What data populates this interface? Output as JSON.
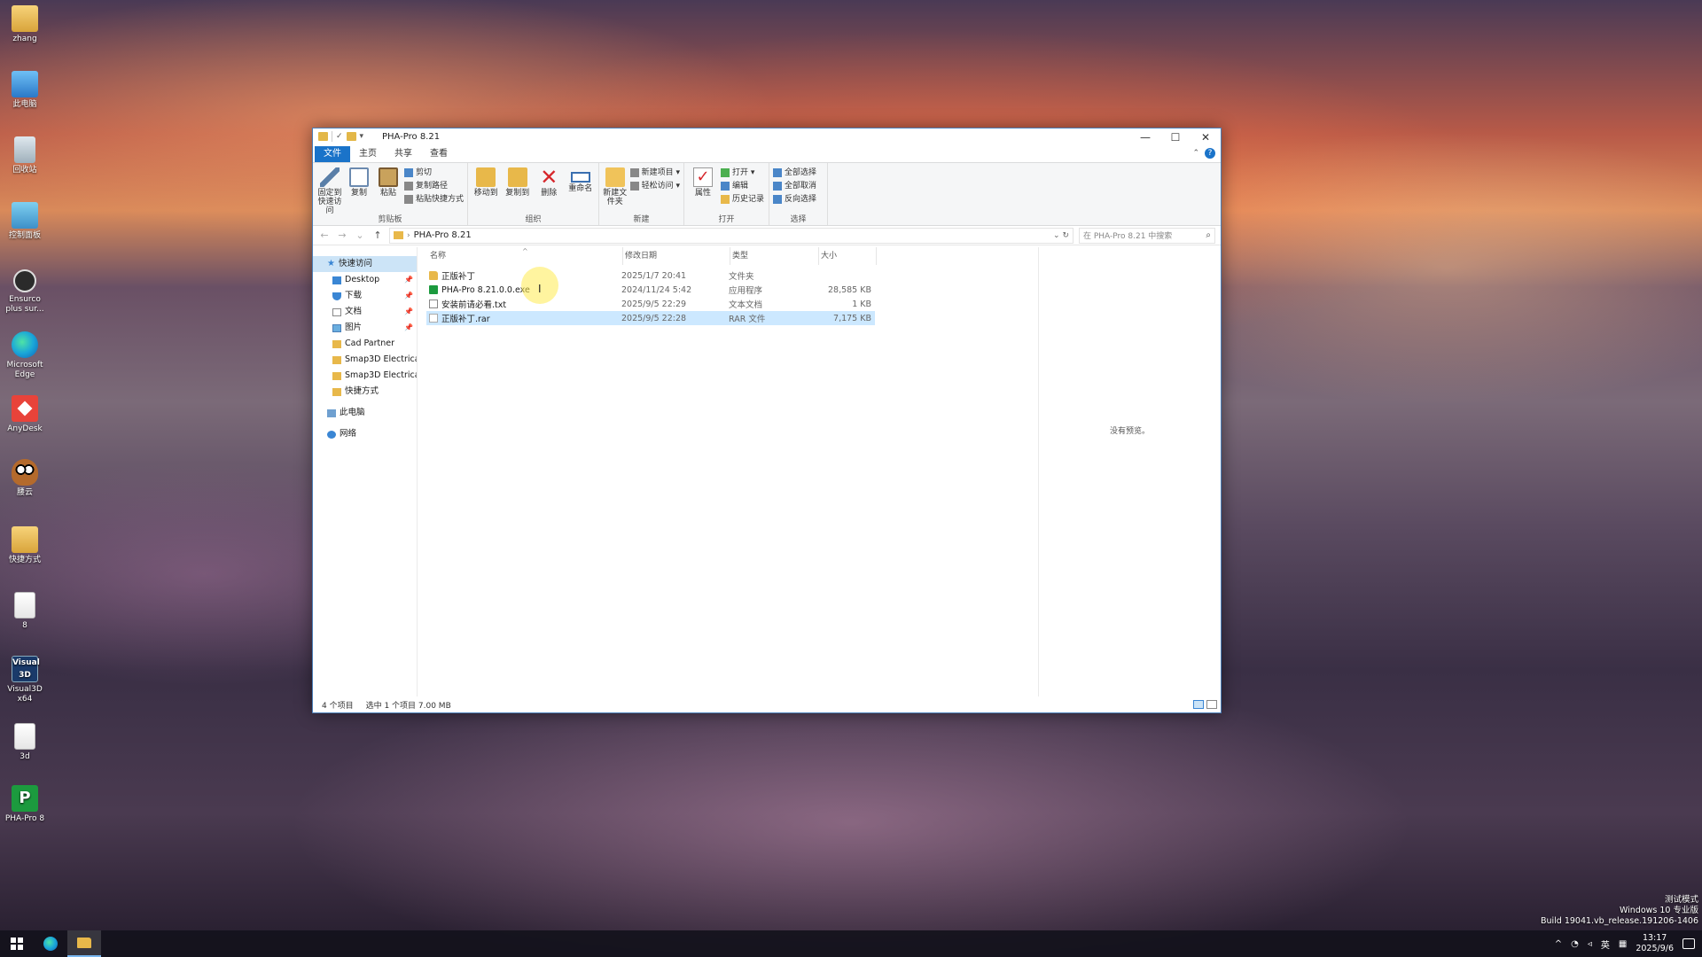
{
  "desktop": {
    "icons": [
      {
        "label": "zhang",
        "icon": "user-folder-icon"
      },
      {
        "label": "此电脑",
        "icon": "this-pc-icon"
      },
      {
        "label": "回收站",
        "icon": "recycle-bin-icon"
      },
      {
        "label": "控制面板",
        "icon": "control-panel-icon"
      },
      {
        "label": "Ensurco plus sur...",
        "icon": "app-circle-icon"
      },
      {
        "label": "Microsoft Edge",
        "icon": "edge-icon"
      },
      {
        "label": "AnyDesk",
        "icon": "anydesk-icon"
      },
      {
        "label": "腰云",
        "icon": "owl-app-icon"
      },
      {
        "label": "快捷方式",
        "icon": "shortcut-folder-icon"
      },
      {
        "label": "8",
        "icon": "document-icon"
      },
      {
        "label": "Visual3D x64",
        "icon": "visual3d-icon"
      },
      {
        "label": "3d",
        "icon": "document-icon"
      },
      {
        "label": "PHA-Pro 8",
        "icon": "pha-pro-icon"
      }
    ]
  },
  "window": {
    "title": "PHA-Pro 8.21",
    "controls": {
      "minimize": "—",
      "maximize": "☐",
      "close": "✕"
    },
    "tabs": [
      "文件",
      "主页",
      "共享",
      "查看"
    ],
    "ribbon": {
      "clipboard": {
        "name": "剪贴板",
        "pin": "固定到快速访问",
        "copy": "复制",
        "paste": "粘贴",
        "cut": "剪切",
        "copy_path": "复制路径",
        "paste_shortcut": "粘贴快捷方式"
      },
      "organize": {
        "name": "组织",
        "move_to": "移动到",
        "copy_to": "复制到",
        "delete": "删除",
        "rename": "重命名"
      },
      "new": {
        "name": "新建",
        "new_folder": "新建文件夹",
        "new_item": "新建项目 ▾",
        "easy_access": "轻松访问 ▾"
      },
      "open": {
        "name": "打开",
        "properties": "属性",
        "open": "打开 ▾",
        "edit": "编辑",
        "history": "历史记录"
      },
      "select": {
        "name": "选择",
        "select_all": "全部选择",
        "select_none": "全部取消",
        "invert": "反向选择"
      }
    },
    "address": {
      "path": "PHA-Pro 8.21",
      "search_placeholder": "在 PHA-Pro 8.21 中搜索"
    },
    "nav": {
      "quick_access": "快速访问",
      "items": [
        {
          "label": "Desktop",
          "pinned": true
        },
        {
          "label": "下载",
          "pinned": true
        },
        {
          "label": "文档",
          "pinned": true
        },
        {
          "label": "图片",
          "pinned": true
        },
        {
          "label": "Cad Partner",
          "pinned": false
        },
        {
          "label": "Smap3D Electrical",
          "pinned": false
        },
        {
          "label": "Smap3D Electrical",
          "pinned": false
        },
        {
          "label": "快捷方式",
          "pinned": false
        }
      ],
      "this_pc": "此电脑",
      "network": "网络"
    },
    "columns": {
      "name": "名称",
      "date": "修改日期",
      "type": "类型",
      "size": "大小"
    },
    "files": [
      {
        "name": "正版补丁",
        "date": "2025/1/7 20:41",
        "type": "文件夹",
        "size": "",
        "kind": "folder"
      },
      {
        "name": "PHA-Pro 8.21.0.0.exe",
        "date": "2024/11/24 5:42",
        "type": "应用程序",
        "size": "28,585 KB",
        "kind": "exe"
      },
      {
        "name": "安装前请必看.txt",
        "date": "2025/9/5 22:29",
        "type": "文本文档",
        "size": "1 KB",
        "kind": "txt"
      },
      {
        "name": "正版补丁.rar",
        "date": "2025/9/5 22:28",
        "type": "RAR 文件",
        "size": "7,175 KB",
        "kind": "rar"
      }
    ],
    "preview_text": "没有预览。",
    "status": {
      "count": "4 个项目",
      "selection": "选中 1 个项目  7.00 MB"
    }
  },
  "taskbar": {
    "tray_lang": "英",
    "time": "13:17",
    "date": "2025/9/6"
  },
  "watermark": {
    "line1": "测试模式",
    "line2": "Windows 10 专业版",
    "line3": "Build 19041.vb_release.191206-1406"
  }
}
